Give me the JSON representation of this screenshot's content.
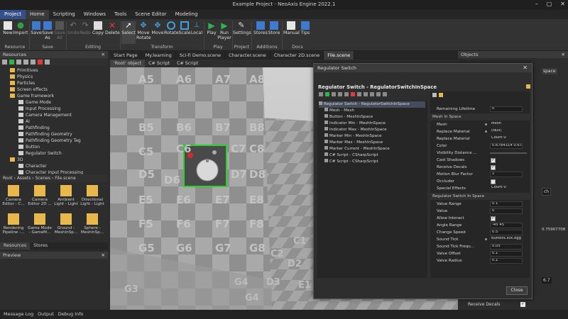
{
  "window": {
    "title": "Example Project - NeoAxis Engine 2022.1"
  },
  "ribbon": {
    "tabs": [
      "Project",
      "Home",
      "Scripting",
      "Windows",
      "Tools",
      "Scene Editor",
      "Modeling"
    ],
    "buttons": [
      {
        "label": "New"
      },
      {
        "label": "Import"
      },
      {
        "label": "Save"
      },
      {
        "label": "Save\nAs"
      },
      {
        "label": "Save\nAll"
      },
      {
        "label": "Undo"
      },
      {
        "label": "Redo"
      },
      {
        "label": "Copy"
      },
      {
        "label": "Delete"
      },
      {
        "label": "Select"
      },
      {
        "label": "Move\nRotate"
      },
      {
        "label": "Move"
      },
      {
        "label": "Rotate"
      },
      {
        "label": "Scale"
      },
      {
        "label": "Local"
      },
      {
        "label": "Play"
      },
      {
        "label": "Run\nPlayer"
      },
      {
        "label": "Settings"
      },
      {
        "label": "Stores"
      },
      {
        "label": "Store"
      },
      {
        "label": "Manual"
      },
      {
        "label": "Tips"
      }
    ],
    "groups": [
      "Resource",
      "Save",
      "Editing",
      "Transform",
      "Play",
      "Project",
      "Additions",
      "Docs"
    ]
  },
  "resources": {
    "title": "Resources",
    "tree": [
      "Primitives",
      "Physics",
      "Particles",
      "Screen effects",
      "Game framework",
      "Game Mode",
      "Input Processing",
      "Camera Management",
      "AI",
      "Pathfinding",
      "Pathfinding Geometry",
      "Pathfinding Geometry Tag",
      "Button",
      "Regulator Switch",
      "3D",
      "Character",
      "Character Input Processing"
    ],
    "path": [
      "Root",
      "Assets",
      "Scenes",
      "File.scene"
    ],
    "assets": [
      "Camera Editor - C...",
      "Camera Editor 2D ...",
      "Ambient Light - Light",
      "Directional Light - Light",
      "Rendering Pipeline -...",
      "Game Mode - GameM...",
      "Ground - MeshInSp...",
      "Sphere - MeshInSp..."
    ],
    "bottom_tabs": [
      "Resources",
      "Stores"
    ]
  },
  "preview": {
    "title": "Preview"
  },
  "bottombar": [
    "Message Log",
    "Output",
    "Debug Info"
  ],
  "doc_tabs": [
    "Start Page",
    "My.learning",
    "Sci-fi Demo.scene",
    "Character.scene",
    "Character 2D.scene",
    "File.scene"
  ],
  "sub_tabs": [
    "'Root' object",
    "C# Script",
    "C# Script"
  ],
  "viewport": {
    "wall_labels": [
      "A5",
      "A6",
      "A7",
      "A8",
      "B5",
      "B6",
      "B7",
      "B8",
      "C5",
      "C6",
      "C7",
      "C8",
      "D5",
      "D6",
      "D7",
      "D8",
      "E5",
      "E6",
      "E7",
      "E8",
      "F5",
      "F6",
      "F7",
      "F8",
      "G5",
      "G6",
      "G7",
      "G8"
    ],
    "floor_labels": [
      "G3",
      "G4",
      "C2",
      "C1",
      "D2",
      "D3",
      "E1",
      "G4"
    ]
  },
  "objects": {
    "title": "Objects",
    "right_labels": [
      "space",
      "ch",
      "0.75907708",
      "6.7",
      "Receive Decals"
    ]
  },
  "dialog": {
    "window_title": "Regulator Switch",
    "header": "Regulator Switch - RegulatorSwitchInSpace",
    "tree": [
      "Regulator Switch - RegulatorSwitchInSpace",
      "Mesh - Mesh",
      "Button - MeshInSpace",
      "Indicator Min - MeshInSpace",
      "Indicator Max - MeshInSpace",
      "Marker Min - MeshInSpace",
      "Marker Max - MeshInSpace",
      "Marker Current - MeshInSpace",
      "C# Script - CSharpScript",
      "C# Script - CSharpScript"
    ],
    "props": [
      {
        "label": "Remaining Lifetime",
        "value": "0",
        "kind": "field"
      },
      {
        "label": "Mesh In Space",
        "kind": "cat"
      },
      {
        "label": "Mesh",
        "value": "Mesh",
        "kind": "field"
      },
      {
        "label": "Replace Material",
        "value": "(Null)",
        "kind": "plain"
      },
      {
        "label": "Replace Material",
        "value": "Count 0",
        "kind": "plain"
      },
      {
        "label": "Color",
        "value": "0.6784314 0.678...",
        "kind": "field"
      },
      {
        "label": "Visibility Distance ...",
        "value": "",
        "kind": "slider"
      },
      {
        "label": "Cast Shadows",
        "value": "✓",
        "kind": "check"
      },
      {
        "label": "Receive Decals",
        "value": "✓",
        "kind": "check"
      },
      {
        "label": "Motion Blur Factor",
        "value": "1",
        "kind": "field"
      },
      {
        "label": "Occluder",
        "value": "",
        "kind": "check"
      },
      {
        "label": "Special Effects",
        "value": "Count 0",
        "kind": "plain"
      },
      {
        "label": "Regulator Switch In Space",
        "kind": "cat"
      },
      {
        "label": "Value Range",
        "value": "0 1",
        "kind": "field"
      },
      {
        "label": "Value",
        "value": "0",
        "kind": "field"
      },
      {
        "label": "Allow Interact",
        "value": "✓",
        "kind": "check"
      },
      {
        "label": "Angle Range",
        "value": "-45 45",
        "kind": "field"
      },
      {
        "label": "Change Speed",
        "value": "0.5",
        "kind": "field"
      },
      {
        "label": "Sound Tick",
        "value": "ButtonClick.ogg",
        "kind": "plain"
      },
      {
        "label": "Sound Tick Frequ...",
        "value": "0.05",
        "kind": "field"
      },
      {
        "label": "Valve Offset",
        "value": "0.1",
        "kind": "field"
      },
      {
        "label": "Valve Radius",
        "value": "0.1",
        "kind": "field"
      }
    ],
    "close_label": "Close"
  }
}
